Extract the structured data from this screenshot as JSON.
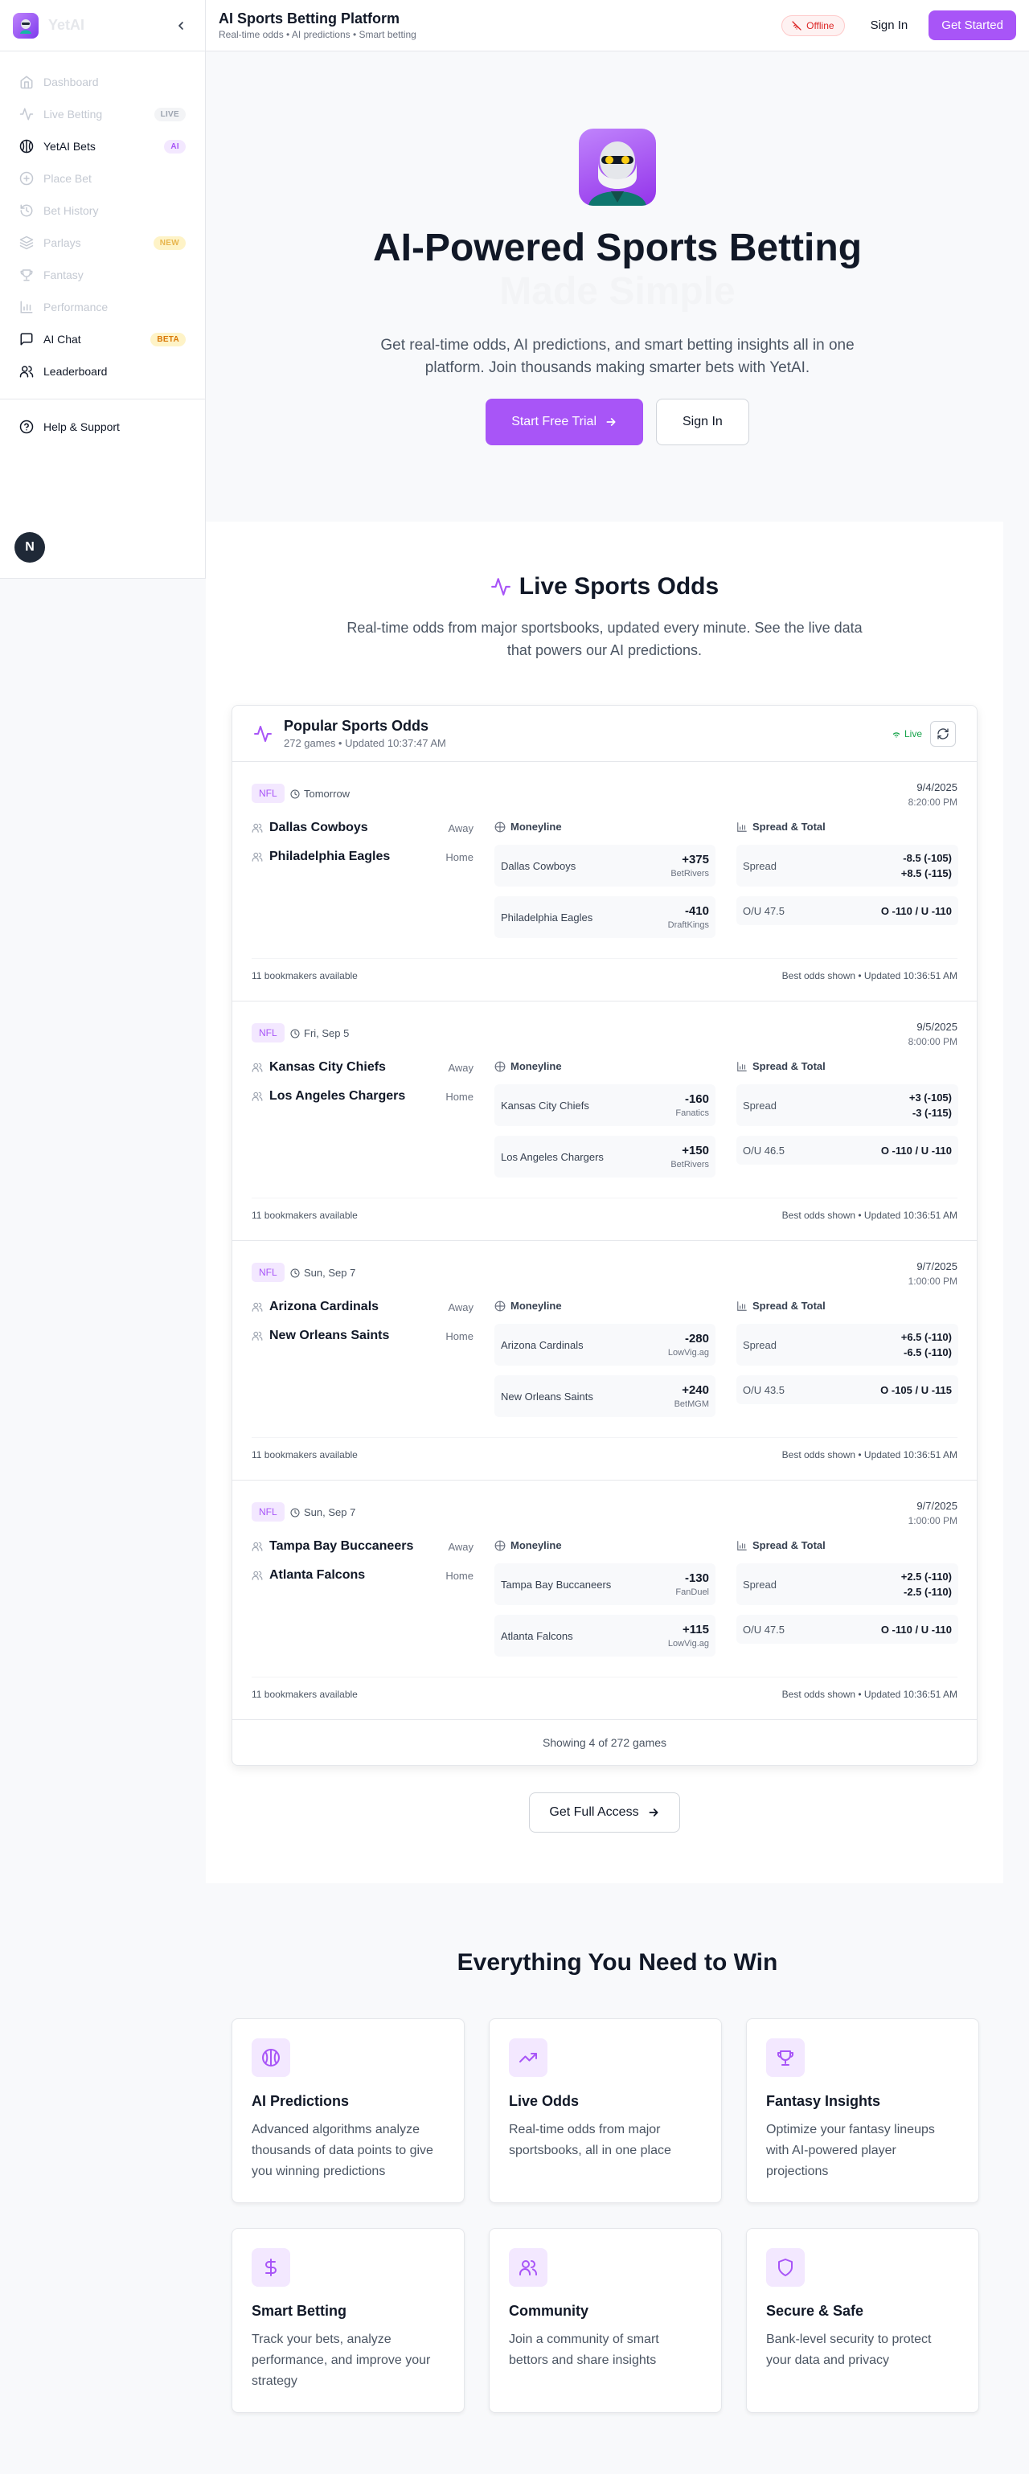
{
  "sidebar": {
    "brand": "YetAI",
    "items": [
      {
        "label": "Dashboard",
        "badge": ""
      },
      {
        "label": "Live Betting",
        "badge": "LIVE"
      },
      {
        "label": "YetAI Bets",
        "badge": "AI"
      },
      {
        "label": "Place Bet",
        "badge": ""
      },
      {
        "label": "Bet History",
        "badge": ""
      },
      {
        "label": "Parlays",
        "badge": "NEW"
      },
      {
        "label": "Fantasy",
        "badge": ""
      },
      {
        "label": "Performance",
        "badge": ""
      },
      {
        "label": "AI Chat",
        "badge": "BETA"
      },
      {
        "label": "Leaderboard",
        "badge": ""
      }
    ],
    "help": "Help & Support",
    "fab": "N"
  },
  "header": {
    "title": "AI Sports Betting Platform",
    "subtitle": "Real-time odds • AI predictions • Smart betting",
    "status": "Offline",
    "sign_in": "Sign In",
    "get_started": "Get Started"
  },
  "hero": {
    "title_line1": "AI-Powered Sports Betting",
    "title_line2": "Made Simple",
    "description": "Get real-time odds, AI predictions, and smart betting insights all in one platform. Join thousands making smarter bets with YetAI.",
    "primary_cta": "Start Free Trial",
    "secondary_cta": "Sign In"
  },
  "odds": {
    "title": "Live Sports Odds",
    "description": "Real-time odds from major sportsbooks, updated every minute. See the live data that powers our AI predictions.",
    "card_title": "Popular Sports Odds",
    "card_subtitle": "272 games • Updated 10:37:47 AM",
    "live_label": "Live",
    "moneyline_label": "Moneyline",
    "spread_total_label": "Spread & Total",
    "spread_label": "Spread",
    "games": [
      {
        "league": "NFL",
        "when": "Tomorrow",
        "date": "9/4/2025",
        "time": "8:20:00 PM",
        "away": "Dallas Cowboys",
        "home": "Philadelphia Eagles",
        "away_label": "Away",
        "home_label": "Home",
        "ml_away_price": "+375",
        "ml_away_book": "BetRivers",
        "ml_home_price": "-410",
        "ml_home_book": "DraftKings",
        "spread_away": "-8.5 (-105)",
        "spread_home": "+8.5 (-115)",
        "ou_label": "O/U 47.5",
        "ou_value": "O -110 / U -110",
        "bookmakers": "11 bookmakers available",
        "updated": "Best odds shown • Updated 10:36:51 AM"
      },
      {
        "league": "NFL",
        "when": "Fri, Sep 5",
        "date": "9/5/2025",
        "time": "8:00:00 PM",
        "away": "Kansas City Chiefs",
        "home": "Los Angeles Chargers",
        "away_label": "Away",
        "home_label": "Home",
        "ml_away_price": "-160",
        "ml_away_book": "Fanatics",
        "ml_home_price": "+150",
        "ml_home_book": "BetRivers",
        "spread_away": "+3 (-105)",
        "spread_home": "-3 (-115)",
        "ou_label": "O/U 46.5",
        "ou_value": "O -110 / U -110",
        "bookmakers": "11 bookmakers available",
        "updated": "Best odds shown • Updated 10:36:51 AM"
      },
      {
        "league": "NFL",
        "when": "Sun, Sep 7",
        "date": "9/7/2025",
        "time": "1:00:00 PM",
        "away": "Arizona Cardinals",
        "home": "New Orleans Saints",
        "away_label": "Away",
        "home_label": "Home",
        "ml_away_price": "-280",
        "ml_away_book": "LowVig.ag",
        "ml_home_price": "+240",
        "ml_home_book": "BetMGM",
        "spread_away": "+6.5 (-110)",
        "spread_home": "-6.5 (-110)",
        "ou_label": "O/U 43.5",
        "ou_value": "O -105 / U -115",
        "bookmakers": "11 bookmakers available",
        "updated": "Best odds shown • Updated 10:36:51 AM"
      },
      {
        "league": "NFL",
        "when": "Sun, Sep 7",
        "date": "9/7/2025",
        "time": "1:00:00 PM",
        "away": "Tampa Bay Buccaneers",
        "home": "Atlanta Falcons",
        "away_label": "Away",
        "home_label": "Home",
        "ml_away_price": "-130",
        "ml_away_book": "FanDuel",
        "ml_home_price": "+115",
        "ml_home_book": "LowVig.ag",
        "spread_away": "+2.5 (-110)",
        "spread_home": "-2.5 (-110)",
        "ou_label": "O/U 47.5",
        "ou_value": "O -110 / U -110",
        "bookmakers": "11 bookmakers available",
        "updated": "Best odds shown • Updated 10:36:51 AM"
      }
    ],
    "showing": "Showing 4 of 272 games",
    "full_access": "Get Full Access"
  },
  "features": {
    "title": "Everything You Need to Win",
    "items": [
      {
        "title": "AI Predictions",
        "desc": "Advanced algorithms analyze thousands of data points to give you winning predictions",
        "icon": "brain-icon"
      },
      {
        "title": "Live Odds",
        "desc": "Real-time odds from major sportsbooks, all in one place",
        "icon": "trending-up-icon"
      },
      {
        "title": "Fantasy Insights",
        "desc": "Optimize your fantasy lineups with AI-powered player projections",
        "icon": "trophy-icon"
      },
      {
        "title": "Smart Betting",
        "desc": "Track your bets, analyze performance, and improve your strategy",
        "icon": "dollar-icon"
      },
      {
        "title": "Community",
        "desc": "Join a community of smart bettors and share insights",
        "icon": "users-icon"
      },
      {
        "title": "Secure & Safe",
        "desc": "Bank-level security to protect your data and privacy",
        "icon": "shield-icon"
      }
    ]
  },
  "colors": {
    "accent": "#a855f7",
    "accent_light": "#f3e8ff",
    "live_green": "#16a34a",
    "offline_red": "#dc2626"
  }
}
